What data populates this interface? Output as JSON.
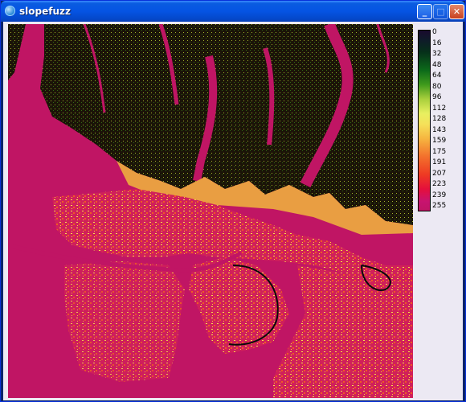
{
  "window": {
    "title": "slopefuzz",
    "minimize_glyph": "_",
    "maximize_glyph": "□",
    "close_glyph": "✕"
  },
  "colors": {
    "titlebar": "#0554e3",
    "background_magenta": "#c01564",
    "land_black": "#000000"
  },
  "legend": {
    "labels": [
      "0",
      "16",
      "32",
      "48",
      "64",
      "80",
      "96",
      "112",
      "128",
      "143",
      "159",
      "175",
      "191",
      "207",
      "223",
      "239",
      "255"
    ]
  }
}
